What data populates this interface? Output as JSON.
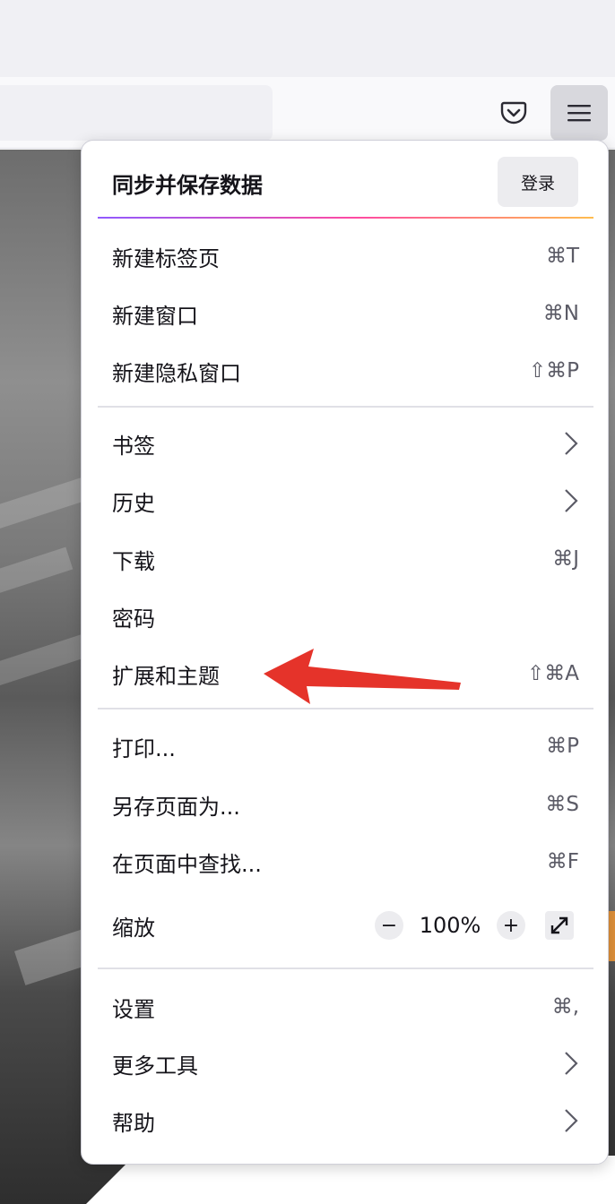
{
  "toolbar": {
    "pocket_icon": "pocket-icon",
    "menu_icon": "hamburger-menu-icon"
  },
  "menu": {
    "sync_title": "同步并保存数据",
    "sign_in_label": "登录",
    "new_tab": {
      "label": "新建标签页",
      "shortcut": "⌘T"
    },
    "new_window": {
      "label": "新建窗口",
      "shortcut": "⌘N"
    },
    "new_private_window": {
      "label": "新建隐私窗口",
      "shortcut": "⇧⌘P"
    },
    "bookmarks": {
      "label": "书签"
    },
    "history": {
      "label": "历史"
    },
    "downloads": {
      "label": "下载",
      "shortcut": "⌘J"
    },
    "passwords": {
      "label": "密码"
    },
    "addons_themes": {
      "label": "扩展和主题",
      "shortcut": "⇧⌘A"
    },
    "print": {
      "label": "打印...",
      "shortcut": "⌘P"
    },
    "save_page_as": {
      "label": "另存页面为...",
      "shortcut": "⌘S"
    },
    "find_in_page": {
      "label": "在页面中查找...",
      "shortcut": "⌘F"
    },
    "zoom": {
      "label": "缩放",
      "minus": "−",
      "value": "100%",
      "plus": "+"
    },
    "settings": {
      "label": "设置",
      "shortcut": "⌘,"
    },
    "more_tools": {
      "label": "更多工具"
    },
    "help": {
      "label": "帮助"
    }
  },
  "colors": {
    "annotation_arrow": "#e5332a",
    "sync_gradient": [
      "#9059ff",
      "#ff4aa2",
      "#ffbd4f"
    ]
  }
}
